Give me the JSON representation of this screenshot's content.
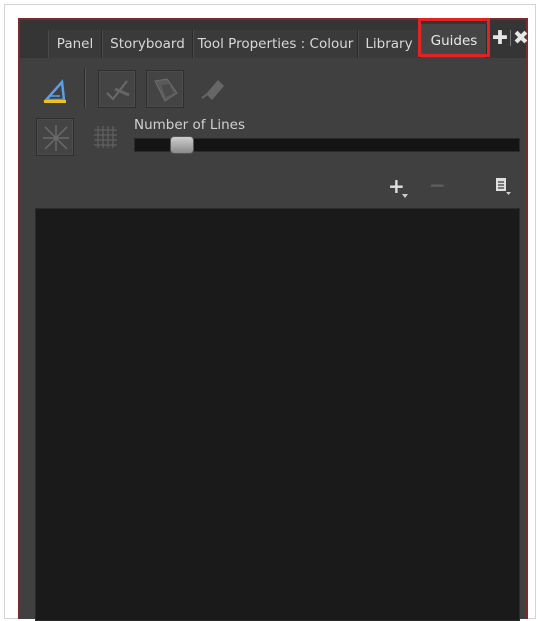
{
  "tabs": [
    {
      "label": "Panel"
    },
    {
      "label": "Storyboard"
    },
    {
      "label": "Tool Properties : Colour"
    },
    {
      "label": "Library"
    },
    {
      "label": "Guides",
      "active": true
    }
  ],
  "tab_controls": {
    "add_icon": "plus-icon",
    "close_icon": "close-icon"
  },
  "toolbar": {
    "icons": [
      "triangle-ruler-icon",
      "perspective-snap-icon",
      "perspective-shade-icon",
      "edit-pen-icon"
    ],
    "row2_icons": [
      "vanishing-lines-icon",
      "grid-icon"
    ]
  },
  "number_of_lines": {
    "label": "Number of Lines",
    "value_fraction": 0.1
  },
  "list_controls": {
    "add_icon": "add-guide-icon",
    "remove_icon": "remove-guide-icon",
    "menu_icon": "guide-menu-icon"
  },
  "colors": {
    "accent_highlight": "#e02424",
    "panel_bg": "#404040",
    "list_bg": "#1a1a1a"
  }
}
